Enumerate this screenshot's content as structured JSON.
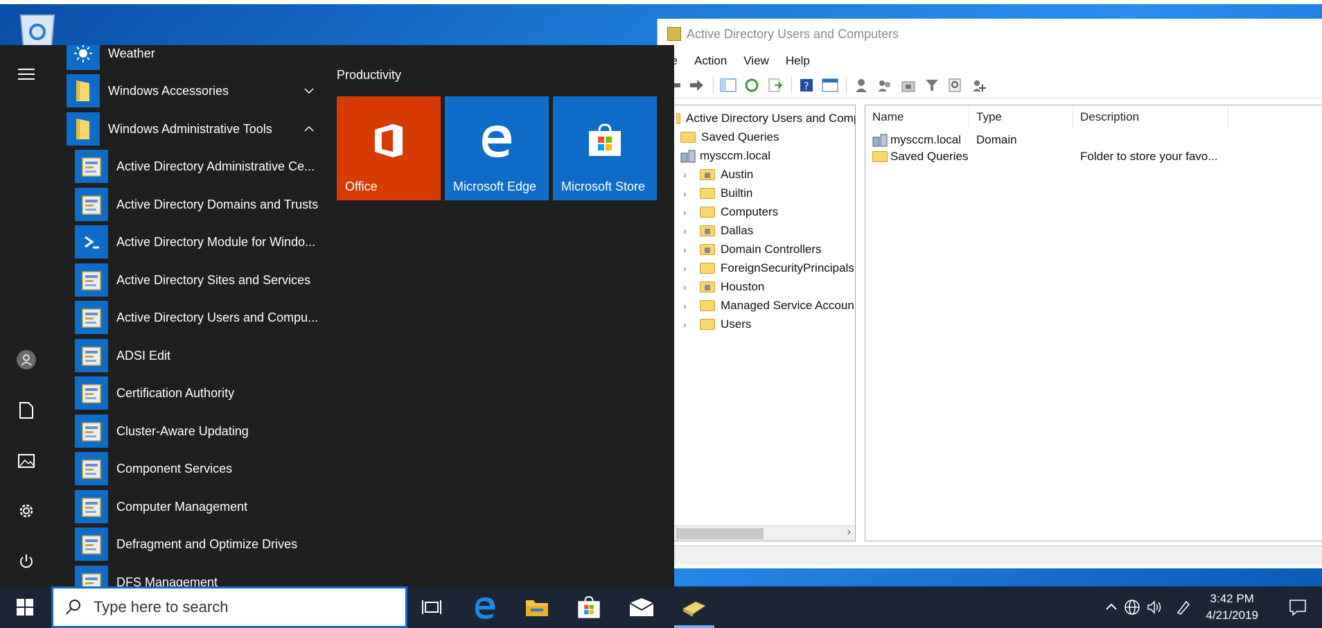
{
  "start_menu": {
    "apps": [
      {
        "label": "Weather",
        "icon": "weather-icon",
        "sub": false
      },
      {
        "label": "Windows Accessories",
        "icon": "folder-icon",
        "sub": false,
        "chevron": "down"
      },
      {
        "label": "Windows Administrative Tools",
        "icon": "folder-icon",
        "sub": false,
        "chevron": "up"
      },
      {
        "label": "Active Directory Administrative Ce...",
        "icon": "ad-admin-center-icon",
        "sub": true
      },
      {
        "label": "Active Directory Domains and Trusts",
        "icon": "ad-domains-trusts-icon",
        "sub": true
      },
      {
        "label": "Active Directory Module for Windo...",
        "icon": "powershell-icon",
        "sub": true
      },
      {
        "label": "Active Directory Sites and Services",
        "icon": "ad-sites-services-icon",
        "sub": true
      },
      {
        "label": "Active Directory Users and Compu...",
        "icon": "ad-users-computers-icon",
        "sub": true
      },
      {
        "label": "ADSI Edit",
        "icon": "adsi-edit-icon",
        "sub": true
      },
      {
        "label": "Certification Authority",
        "icon": "cert-authority-icon",
        "sub": true
      },
      {
        "label": "Cluster-Aware Updating",
        "icon": "cluster-updating-icon",
        "sub": true
      },
      {
        "label": "Component Services",
        "icon": "component-services-icon",
        "sub": true
      },
      {
        "label": "Computer Management",
        "icon": "computer-management-icon",
        "sub": true
      },
      {
        "label": "Defragment and Optimize Drives",
        "icon": "defrag-icon",
        "sub": true
      },
      {
        "label": "DFS Management",
        "icon": "dfs-management-icon",
        "sub": true
      }
    ],
    "tiles_group": "Productivity",
    "tiles": [
      {
        "label": "Office",
        "color": "#d83b01",
        "icon": "office-icon"
      },
      {
        "label": "Microsoft Edge",
        "color": "#0f6cc8",
        "icon": "edge-icon"
      },
      {
        "label": "Microsoft Store",
        "color": "#0f6cc8",
        "icon": "store-icon"
      }
    ]
  },
  "ad_window": {
    "title": "Active Directory Users and Computers",
    "menu": [
      "ile",
      "Action",
      "View",
      "Help"
    ],
    "tree": [
      {
        "label": "Active Directory Users and Comp",
        "level": 0,
        "type": "root"
      },
      {
        "label": "Saved Queries",
        "level": 1,
        "type": "folder"
      },
      {
        "label": "mysccm.local",
        "level": 1,
        "type": "domain"
      },
      {
        "label": "Austin",
        "level": 2,
        "type": "ou"
      },
      {
        "label": "Builtin",
        "level": 2,
        "type": "folder"
      },
      {
        "label": "Computers",
        "level": 2,
        "type": "folder"
      },
      {
        "label": "Dallas",
        "level": 2,
        "type": "ou"
      },
      {
        "label": "Domain Controllers",
        "level": 2,
        "type": "ou"
      },
      {
        "label": "ForeignSecurityPrincipals",
        "level": 2,
        "type": "folder"
      },
      {
        "label": "Houston",
        "level": 2,
        "type": "ou"
      },
      {
        "label": "Managed Service Accoun",
        "level": 2,
        "type": "folder"
      },
      {
        "label": "Users",
        "level": 2,
        "type": "folder"
      }
    ],
    "columns": [
      "Name",
      "Type",
      "Description"
    ],
    "rows": [
      {
        "name": "mysccm.local",
        "type": "Domain",
        "description": "",
        "icon": "domain-icon"
      },
      {
        "name": "Saved Queries",
        "type": "",
        "description": "Folder to store your favo...",
        "icon": "folder-icon"
      }
    ]
  },
  "taskbar": {
    "search_placeholder": "Type here to search",
    "time": "3:42 PM",
    "date": "4/21/2019"
  },
  "colors": {
    "accent": "#0f6cc8",
    "office_tile": "#d83b01",
    "taskbar": "#1b2536",
    "start_bg": "#1f1f1f"
  }
}
